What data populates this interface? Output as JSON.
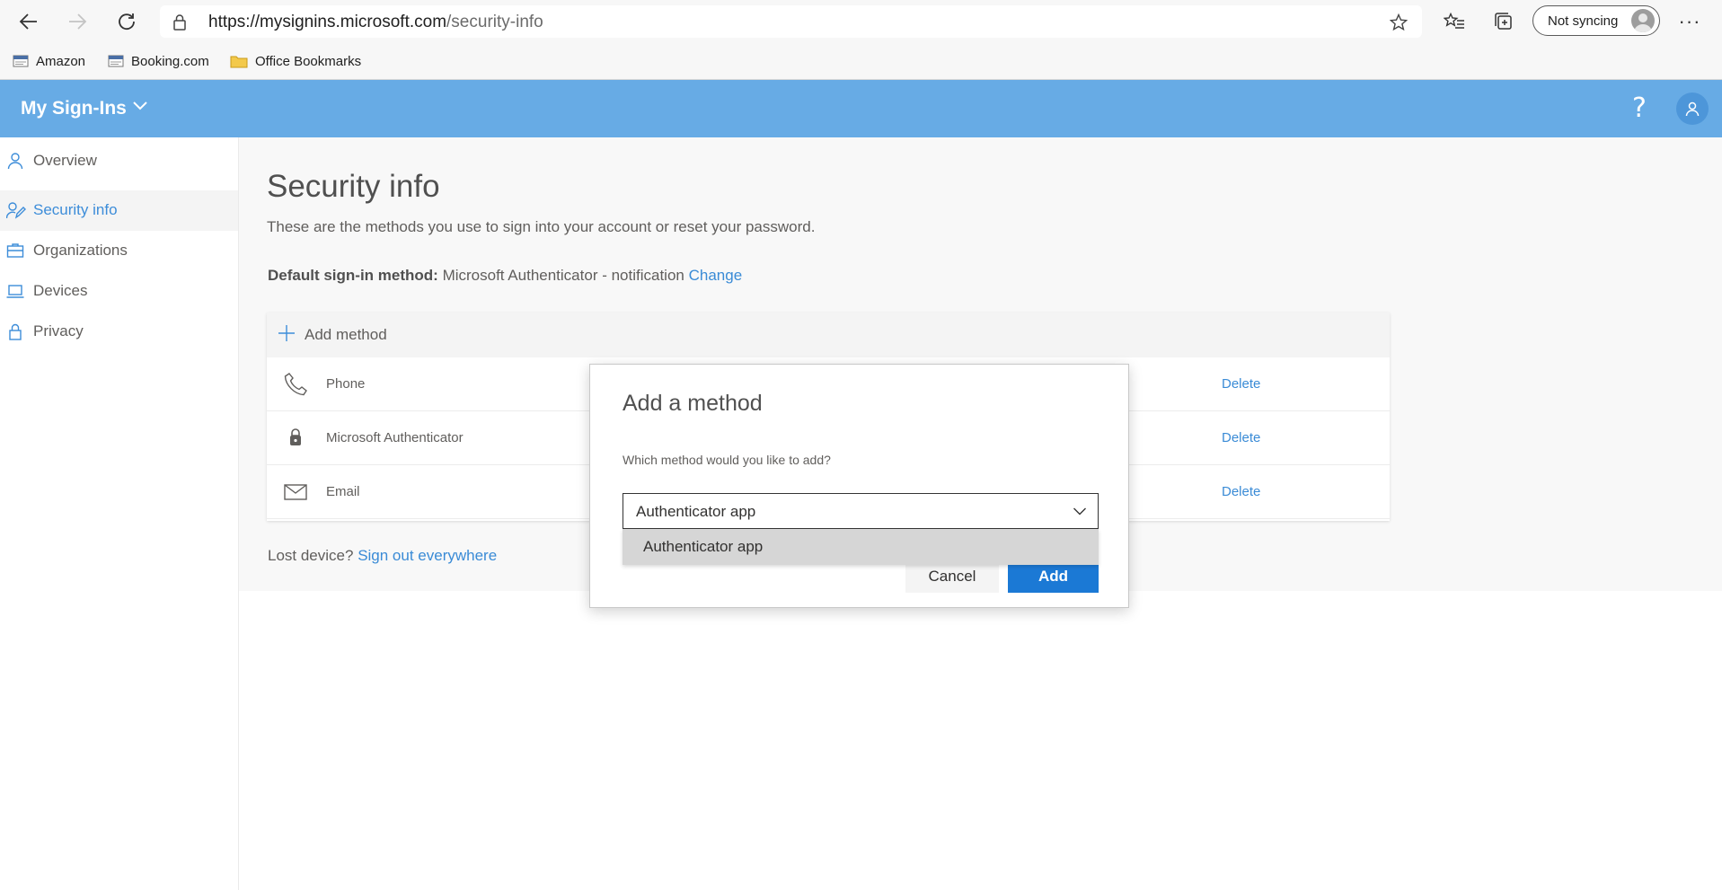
{
  "browser": {
    "url_host": "https://mysignins.microsoft.com",
    "url_path": "/security-info",
    "sync_label": "Not syncing",
    "more_label": "···",
    "bookmarks": [
      {
        "label": "Amazon"
      },
      {
        "label": "Booking.com"
      },
      {
        "label": "Office Bookmarks"
      }
    ]
  },
  "header": {
    "title": "My Sign-Ins",
    "help_label": "?"
  },
  "sidebar": {
    "items": [
      {
        "label": "Overview",
        "icon": "person-icon"
      },
      {
        "label": "Security info",
        "icon": "security-info-icon",
        "active": true
      },
      {
        "label": "Organizations",
        "icon": "briefcase-icon"
      },
      {
        "label": "Devices",
        "icon": "laptop-icon"
      },
      {
        "label": "Privacy",
        "icon": "lock-icon"
      }
    ]
  },
  "main": {
    "title": "Security info",
    "subtitle": "These are the methods you use to sign into your account or reset your password.",
    "default_method_label": "Default sign-in method:",
    "default_method_value": "Microsoft Authenticator - notification",
    "change_link": "Change",
    "add_method_label": "Add method",
    "methods": [
      {
        "label": "Phone",
        "icon": "phone-icon",
        "delete_label": "Delete"
      },
      {
        "label": "Microsoft Authenticator",
        "icon": "authenticator-lock-icon",
        "delete_label": "Delete"
      },
      {
        "label": "Email",
        "icon": "mail-icon",
        "delete_label": "Delete"
      }
    ],
    "lost_device_text": "Lost device?",
    "sign_out_link": "Sign out everywhere"
  },
  "dialog": {
    "title": "Add a method",
    "question": "Which method would you like to add?",
    "selected_value": "Authenticator app",
    "options": [
      "Authenticator app"
    ],
    "cancel_label": "Cancel",
    "add_label": "Add"
  },
  "colors": {
    "header_bg": "#67abe5",
    "link": "#3a8bd6",
    "primary_button": "#1b79d5",
    "active_nav_text": "#3d8dd9"
  }
}
